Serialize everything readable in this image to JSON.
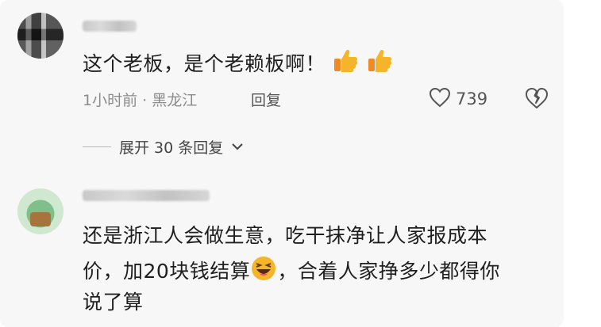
{
  "comments": [
    {
      "text": "这个老板，是个老赖板啊！",
      "meta": "1小时前 · 黑龙江",
      "reply_label": "回复",
      "likes": "739",
      "replies_label": "展开 30 条回复",
      "emoji": [
        "thumbs-up-icon",
        "thumbs-up-icon"
      ]
    },
    {
      "line1": "还是浙江人会做生意，吃干抹净让人家报成本",
      "line2_a": "价，加20块钱结算",
      "line2_b": "，合着人家挣多少都得你",
      "line3": "说了算",
      "emoji": "laughing-face-icon"
    }
  ],
  "colors": {
    "panel": "#f7f7f7",
    "text": "#1f1f1f",
    "muted": "#8c8c8c",
    "thumb": "#f5b52a"
  }
}
